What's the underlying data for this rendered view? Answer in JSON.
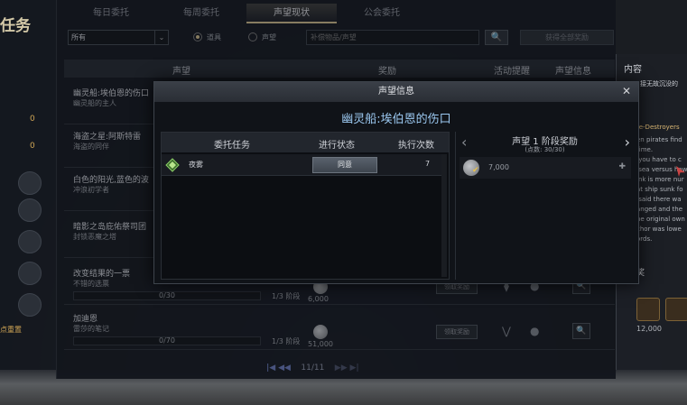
{
  "left": {
    "title": "任务",
    "counts": [
      "0",
      "0"
    ],
    "reset": "点重置"
  },
  "tabs": [
    "每日委托",
    "每周委托",
    "声望现状",
    "公会委托"
  ],
  "filter": {
    "select_value": "所有",
    "radio_1": "道具",
    "radio_2": "声望",
    "search_placeholder": "补偿物品/声望",
    "search_icon": "🔍",
    "show_all": "获得全部奖励"
  },
  "table_headers": {
    "reputation": "声望",
    "reward": "奖励",
    "event": "活动提醒",
    "info": "声望信息"
  },
  "rows": [
    {
      "name": "幽灵船:埃伯恩的伤口",
      "sub": "幽灵船的主人"
    },
    {
      "name": "海盗之星:阿斯特雷",
      "sub": "海盗的同伴"
    },
    {
      "name": "白色的阳光,蓝色的波",
      "sub": "冲浪初学者"
    },
    {
      "name": "暗影之岛庇佑祭司团",
      "sub": "封锁恶魔之塔"
    },
    {
      "name": "改变结果的一票",
      "sub": "不错的选票",
      "progress": "0/30",
      "stage": "1/3 阶段",
      "reward": "6,000",
      "button": "领取奖励"
    },
    {
      "name": "加迪恩",
      "sub": "雷莎的笔记",
      "progress": "0/70",
      "stage": "1/3 阶段",
      "reward": "51,000",
      "button": "领取奖励"
    }
  ],
  "pagination": {
    "first": "|◀",
    "prev": "◀◀",
    "page": "11/11",
    "next": "▶▶",
    "last": "▶|"
  },
  "right_panel": {
    "header": "内容",
    "sub": "接无故沉没的",
    "quest_title": "re-Destroyers",
    "story": "en pirates find\ntime.\n you have to c\n sea versus how\nink is more nur\nat ship sunk fo\n said there wa\nanged and the\nhe original own\nchor was lowe\nords.",
    "reward_label": "奖",
    "item_qty": "12,000"
  },
  "modal": {
    "title": "声望信息",
    "close": "✕",
    "subtitle": "幽灵船:埃伯恩的伤口",
    "quest_headers": {
      "task": "委托任务",
      "status": "进行状态",
      "count": "执行次数"
    },
    "quest_row": {
      "name": "夜雾",
      "status": "同意",
      "count": "7"
    },
    "reward_pane": {
      "prev": "‹",
      "next": "›",
      "title": "声望 1 阶段奖励",
      "progress": "(点数: 30/30)",
      "item_value": "7,000",
      "check": "✔",
      "fav": "✚"
    }
  },
  "colors": {
    "accent_gold": "#cbb98a",
    "title_blue": "#9bc8f0",
    "background": "#1a1d22"
  }
}
